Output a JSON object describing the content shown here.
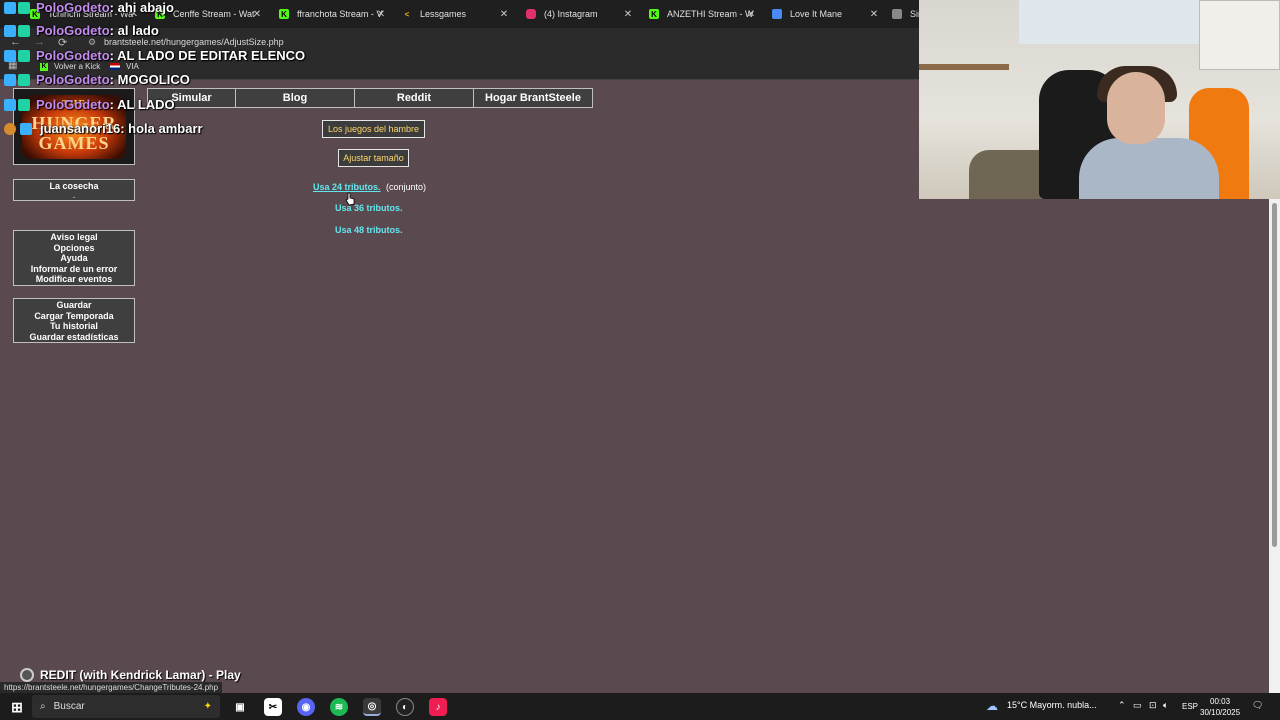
{
  "browser": {
    "tabs": [
      {
        "label": "Tchinchi Stream - Wa",
        "icon": "kick-icon",
        "color": "#53fc18"
      },
      {
        "label": "Cenffe Stream - Wat",
        "icon": "kick-icon",
        "color": "#53fc18"
      },
      {
        "label": "ffranchota Stream - V",
        "icon": "kick-icon",
        "color": "#53fc18"
      },
      {
        "label": "Lessgames",
        "icon": "lessgames-icon",
        "color": "#f2b400"
      },
      {
        "label": "(4) Instagram",
        "icon": "instagram-icon",
        "color": "#e1306c"
      },
      {
        "label": "ANZETHI Stream - W",
        "icon": "kick-icon",
        "color": "#53fc18"
      },
      {
        "label": "Love It Mane",
        "icon": "page-icon",
        "color": "#4a8af4"
      },
      {
        "label": "Sir",
        "icon": "brantsteele-icon",
        "color": "#888888"
      }
    ],
    "url": "brantsteele.net/hungergames/AdjustSize.php",
    "bookmarks": [
      {
        "label": "Volver a Kick",
        "icon": "kick-icon"
      },
      {
        "label": "VIA",
        "icon": "flag-icon"
      }
    ]
  },
  "chat": [
    {
      "user": "PoloGodeto",
      "message": ": ahi abajo"
    },
    {
      "user": "PoloGodeto",
      "message": ": al lado"
    },
    {
      "user": "PoloGodeto",
      "message": ": AL LADO DE EDITAR ELENCO"
    },
    {
      "user": "PoloGodeto",
      "message": ": MOGOLICO"
    },
    {
      "user": "PoloGodeto",
      "message": ": AL LADO"
    },
    {
      "user": "juansanori16",
      "message": ": hola ambarr"
    }
  ],
  "logo": {
    "line1": "THE",
    "line2": "HUNGER",
    "line3": "GAMES"
  },
  "nav": [
    "Simular",
    "Blog",
    "Reddit",
    "Hogar BrantSteele"
  ],
  "sidebar": {
    "box1": [
      "La cosecha",
      "-"
    ],
    "box2": [
      "Aviso legal",
      "Opciones",
      "Ayuda",
      "Informar de un error",
      "Modificar eventos"
    ],
    "box3": [
      "Guardar",
      "Cargar Temporada",
      "Tu historial",
      "Guardar estadísticas"
    ]
  },
  "main": {
    "title_button": "Los juegos del hambre",
    "adjust_button": "Ajustar tamaño",
    "option1_link": "Usa 24 tributos.",
    "option1_note": "(conjunto)",
    "option2_link": "Usa 36 tributos.",
    "option3_link": "Usa 48 tributos."
  },
  "player": {
    "now_playing": "REDIT (with Kendrick Lamar) - Play"
  },
  "status_url": "https://brantsteele.net/hungergames/ChangeTributes-24.php",
  "taskbar": {
    "search_placeholder": "Buscar",
    "weather": "15°C  Mayorm. nubla...",
    "lang": "ESP",
    "time": "00:03",
    "date": "30/10/2025"
  },
  "colors": {
    "page_bg": "#5a4a4f",
    "link": "#63e6ef",
    "button_text": "#ffd66b",
    "chat_user": "#c48bf0"
  }
}
